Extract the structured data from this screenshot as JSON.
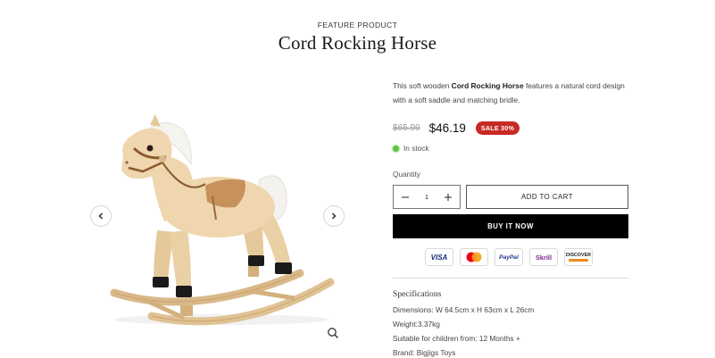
{
  "header": {
    "eyebrow": "FEATURE PRODUCT",
    "title": "Cord Rocking Horse"
  },
  "gallery": {
    "image": "rocking-horse-photo",
    "prev_icon": "chevron-left-icon",
    "next_icon": "chevron-right-icon",
    "zoom_icon": "magnifier-icon"
  },
  "product": {
    "description_prefix": "This soft wooden ",
    "description_name": "Cord Rocking Horse",
    "description_suffix": " features a natural cord design with a soft saddle and matching bridle.",
    "old_price": "$65.99",
    "price": "$46.19",
    "sale_badge": "SALE 30%",
    "stock": "In stock",
    "stock_color": "#5ec442",
    "sale_color": "#c72a23"
  },
  "purchase": {
    "quantity_label": "Quantity",
    "quantity": "1",
    "add_to_cart": "ADD TO CART",
    "buy_now": "BUY IT NOW"
  },
  "payments": [
    "VISA",
    "Mastercard",
    "PayPal",
    "Skrill",
    "DISCOVER"
  ],
  "specs": {
    "heading": "Specifications",
    "items": [
      "Dimensions: W 64.5cm x H 63cm x L 26cm",
      "Weight:3.37kg",
      "Suitable for children from: 12 Months +",
      "Brand: Bigjigs Toys"
    ]
  }
}
